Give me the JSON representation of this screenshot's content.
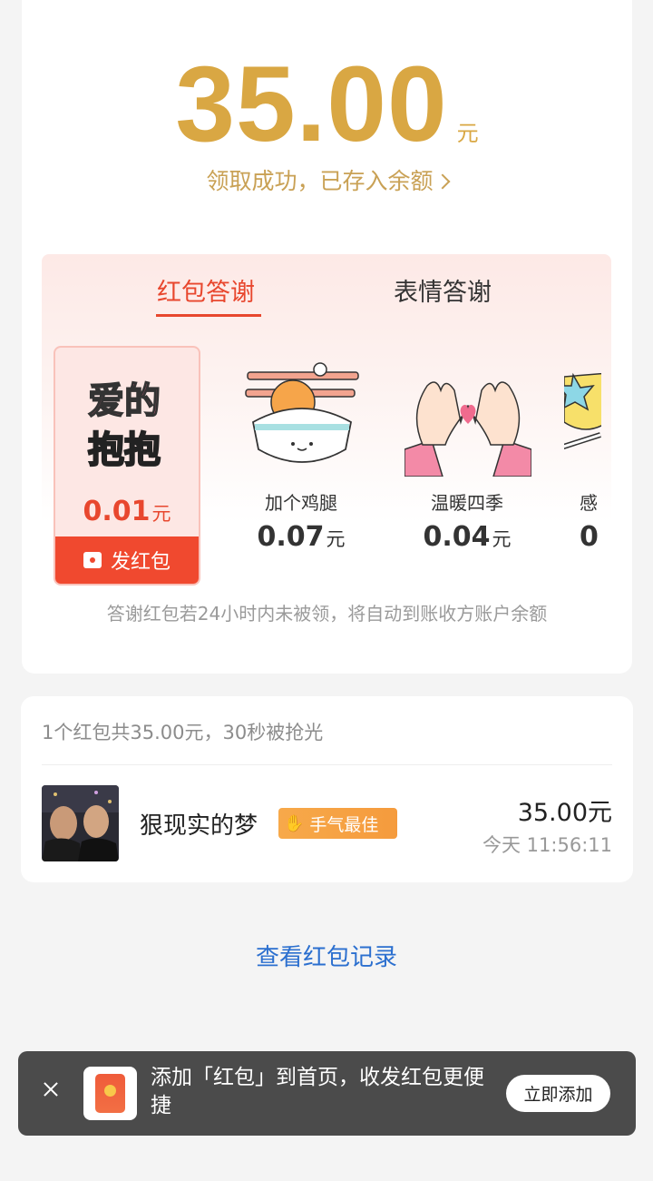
{
  "header": {
    "amount": "35.00",
    "unit": "元",
    "status": "领取成功，已存入余额"
  },
  "thanks": {
    "tabs": [
      "红包答谢",
      "表情答谢"
    ],
    "items": [
      {
        "name": "爱的抱抱",
        "price": "0.01",
        "unit": "元",
        "button": "发红包"
      },
      {
        "name": "加个鸡腿",
        "price": "0.07",
        "unit": "元"
      },
      {
        "name": "温暖四季",
        "price": "0.04",
        "unit": "元"
      },
      {
        "name": "感",
        "price": "0"
      }
    ],
    "note": "答谢红包若24小时内未被领，将自动到账收方账户余额"
  },
  "summary": {
    "text": "1个红包共35.00元，30秒被抢光",
    "user": {
      "name": "狠现实的梦",
      "badge": "手气最佳",
      "amount": "35.00元",
      "time": "今天 11:56:11"
    }
  },
  "records_link": "查看红包记录",
  "toast": {
    "text": "添加「红包」到首页，收发红包更便捷",
    "button": "立即添加"
  }
}
